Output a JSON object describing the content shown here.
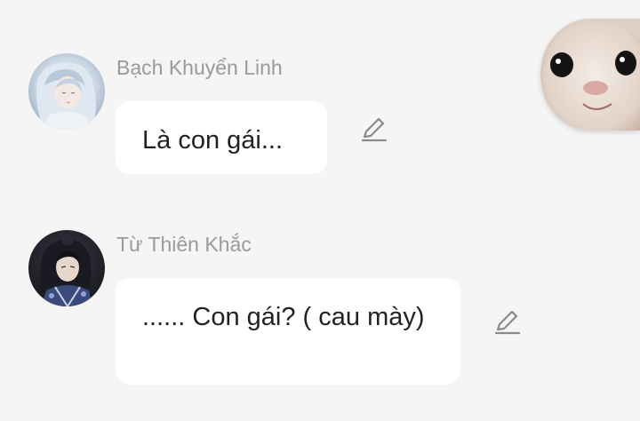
{
  "messages": [
    {
      "sender": "Bạch Khuyển Linh",
      "text": "Là con gái...",
      "avatar_icon": "silver-haired-girl-avatar",
      "edit_icon": "pencil-edit-icon"
    },
    {
      "sender": "Từ Thiên Khắc",
      "text": "...... Con gái? ( cau mày)",
      "avatar_icon": "dark-robed-man-avatar",
      "edit_icon": "pencil-edit-icon"
    }
  ],
  "user_avatar": {
    "icon": "cat-face-avatar"
  },
  "colors": {
    "background": "#f5f5f5",
    "bubble": "#ffffff",
    "sender_name": "#9a9a9a",
    "text": "#222222",
    "icon": "#8a8a8a"
  }
}
